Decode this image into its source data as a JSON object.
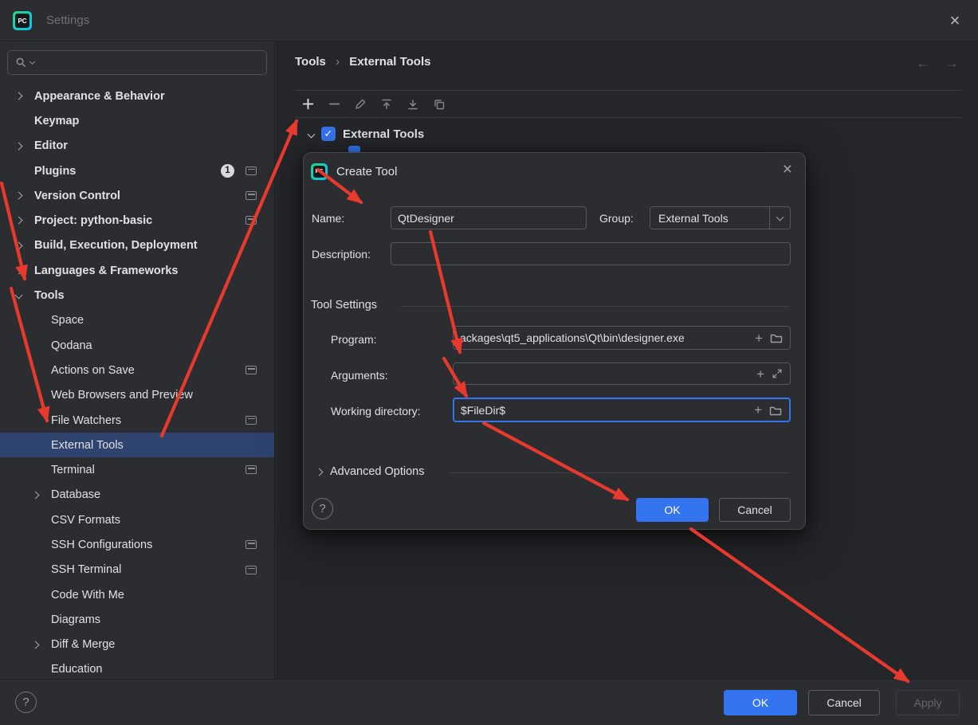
{
  "window": {
    "title": "Settings",
    "logo_text": "PC"
  },
  "icons": {
    "close": "×",
    "back": "←",
    "forward": "→",
    "check": "✓",
    "help": "?",
    "plus": "+"
  },
  "sidebar": {
    "search": {
      "placeholder": ""
    },
    "items": [
      {
        "label": "Appearance & Behavior"
      },
      {
        "label": "Keymap"
      },
      {
        "label": "Editor"
      },
      {
        "label": "Plugins",
        "badge": "1"
      },
      {
        "label": "Version Control"
      },
      {
        "label": "Project: python-basic"
      },
      {
        "label": "Build, Execution, Deployment"
      },
      {
        "label": "Languages & Frameworks"
      },
      {
        "label": "Tools"
      },
      {
        "label": "Space"
      },
      {
        "label": "Qodana"
      },
      {
        "label": "Actions on Save"
      },
      {
        "label": "Web Browsers and Preview"
      },
      {
        "label": "File Watchers"
      },
      {
        "label": "External Tools"
      },
      {
        "label": "Terminal"
      },
      {
        "label": "Database"
      },
      {
        "label": "CSV Formats"
      },
      {
        "label": "SSH Configurations"
      },
      {
        "label": "SSH Terminal"
      },
      {
        "label": "Code With Me"
      },
      {
        "label": "Diagrams"
      },
      {
        "label": "Diff & Merge"
      },
      {
        "label": "Education"
      }
    ]
  },
  "content": {
    "breadcrumb": {
      "root": "Tools",
      "sep": "›",
      "current": "External Tools"
    },
    "tree": {
      "root_label": "External Tools",
      "root_checked": true
    }
  },
  "dialog": {
    "title": "Create Tool",
    "fields": {
      "name_label": "Name:",
      "name_value": "QtDesigner",
      "group_label": "Group:",
      "group_value": "External Tools",
      "description_label": "Description:",
      "description_value": "",
      "section_title": "Tool Settings",
      "program_label": "Program:",
      "program_value": "ackages\\qt5_applications\\Qt\\bin\\designer.exe",
      "arguments_label": "Arguments:",
      "arguments_value": "",
      "workdir_label": "Working directory:",
      "workdir_value": "$FileDir$"
    },
    "advanced_label": "Advanced Options",
    "ok_label": "OK",
    "cancel_label": "Cancel"
  },
  "footer": {
    "ok": "OK",
    "cancel": "Cancel",
    "apply": "Apply"
  },
  "colors": {
    "accent": "#3574f0",
    "selection": "#2e436e",
    "arrow": "#e8392e"
  }
}
